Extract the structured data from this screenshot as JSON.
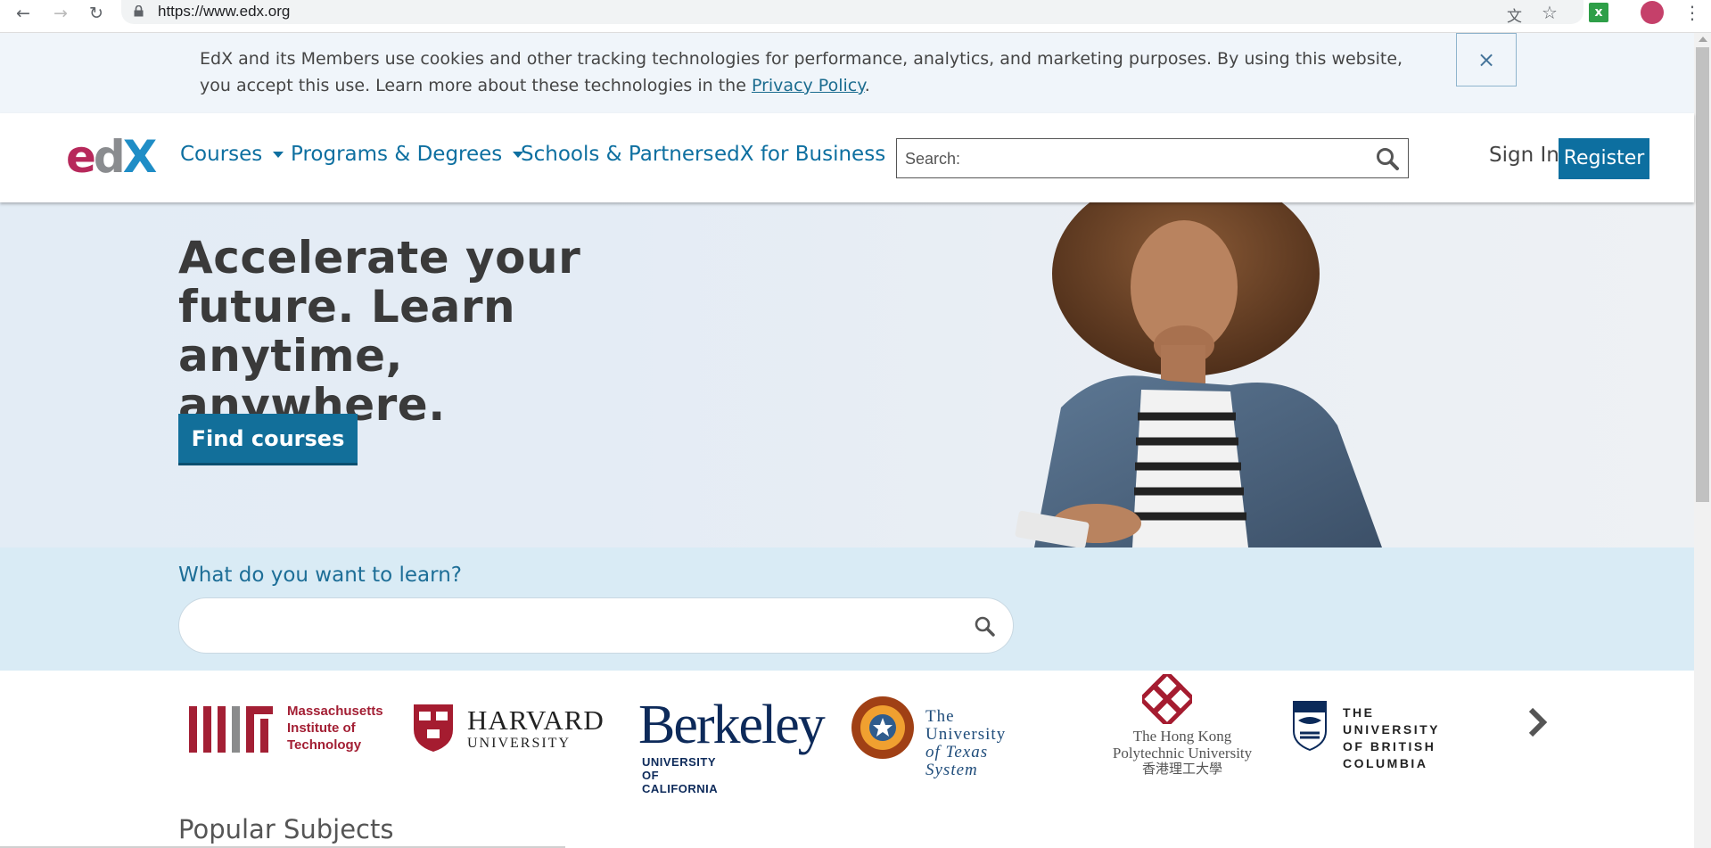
{
  "browser": {
    "url": "https://www.edx.org"
  },
  "cookie_banner": {
    "message": "EdX and its Members use cookies and other tracking technologies for performance, analytics, and marketing purposes. By using this website, you accept this use. Learn more about these technologies in the ",
    "link_text": "Privacy Policy",
    "suffix": ".",
    "close_label": "×"
  },
  "header": {
    "logo": {
      "e": "e",
      "d": "d",
      "x": "X"
    },
    "nav": [
      {
        "label": "Courses",
        "has_dropdown": true
      },
      {
        "label": "Programs & Degrees",
        "has_dropdown": true
      },
      {
        "label": "Schools & Partners",
        "has_dropdown": false
      },
      {
        "label": "edX for Business",
        "has_dropdown": false
      }
    ],
    "search_placeholder": "Search:",
    "sign_in": "Sign In",
    "register": "Register"
  },
  "hero": {
    "headline": "Accelerate your future. Learn anytime, anywhere.",
    "cta": "Find courses"
  },
  "learn_search": {
    "label": "What do you want to learn?",
    "value": ""
  },
  "partners": {
    "mit": "Massachusetts Institute of Technology",
    "mit_lines": [
      "Massachusetts",
      "Institute of",
      "Technology"
    ],
    "harvard": [
      "HARVARD",
      "UNIVERSITY"
    ],
    "berkeley": [
      "Berkeley",
      "UNIVERSITY OF CALIFORNIA"
    ],
    "utx": [
      "The University",
      "of Texas System"
    ],
    "polyu": [
      "The Hong Kong",
      "Polytechnic University",
      "香港理工大學"
    ],
    "ubc": [
      "THE UNIVERSITY",
      "OF BRITISH COLUMBIA"
    ]
  },
  "sections": {
    "popular_subjects": "Popular Subjects"
  },
  "colors": {
    "brand_blue": "#0d6fa0",
    "edx_magenta": "#b7295b",
    "cookie_bg": "#f0f5fa",
    "learn_bg": "#d9ebf5"
  }
}
